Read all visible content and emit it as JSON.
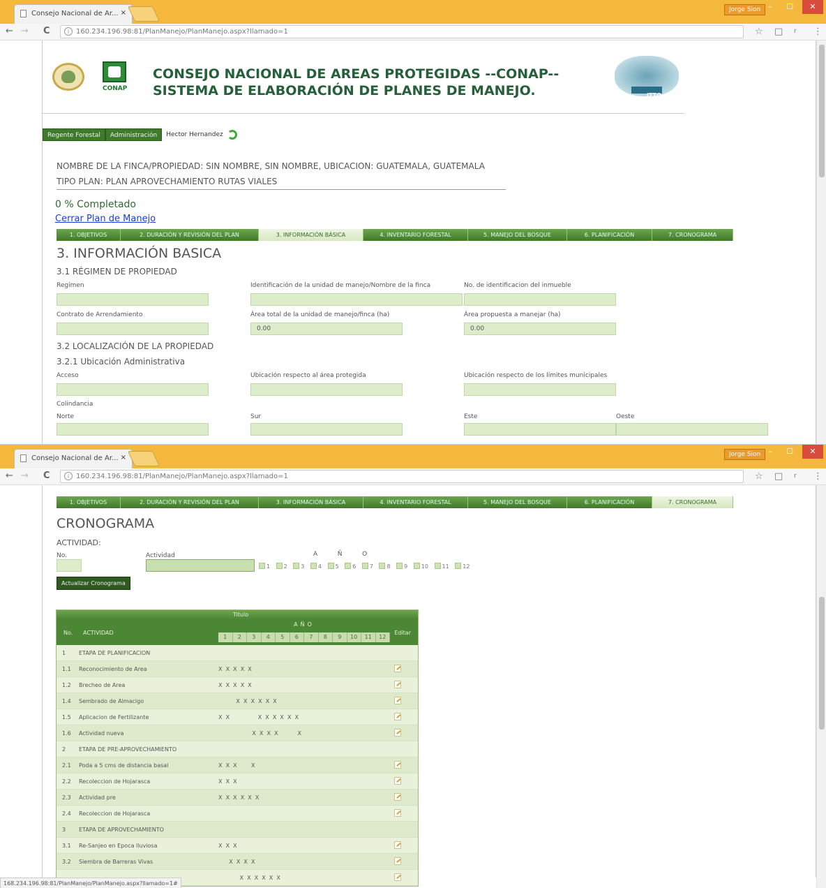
{
  "browser": {
    "tab_title": "Consejo Nacional de Ar...",
    "tab_close": "×",
    "user_name": "Jorge Sion",
    "url": "160.234.196.98:81/PlanManejo/PlanManejo.aspx?llamado=1",
    "status_url": "168.234.196.98:81/PlanManejo/PlanManejo.aspx?llamado=1#",
    "back": "←",
    "forward": "→",
    "reload": "C",
    "info": "i",
    "star": "☆",
    "ext": "□",
    "menu": "⋮",
    "r": "r",
    "min": "–",
    "max": "☐",
    "close": "✕"
  },
  "header": {
    "line1": "CONSEJO NACIONAL DE AREAS PROTEGIDAS --CONAP--",
    "line2": "SISTEMA DE ELABORACIÓN DE PLANES DE MANEJO.",
    "conap_logo_text": "CONAP",
    "itto_logo_text": "ITTO"
  },
  "menu": {
    "items": [
      "Regente Forestal",
      "Administración"
    ],
    "user": "Hector Hernandez"
  },
  "finca": {
    "line1": "NOMBRE DE LA FINCA/PROPIEDAD: SIN NOMBRE, SIN NOMBRE, UBICACION: GUATEMALA, GUATEMALA",
    "line2": "TIPO PLAN: PLAN APROVECHAMIENTO RUTAS VIALES"
  },
  "progress": {
    "text": "0 % Completado",
    "value_percent": 0
  },
  "cerrar": "Cerrar Plan de Manejo",
  "steps": [
    "1. OBJETIVOS",
    "2. DURACIÓN Y REVISIÓN DEL PLAN",
    "3. INFORMACIÓN BÁSICA",
    "4. INVENTARIO FORESTAL",
    "5. MANEJO DEL BOSQUE",
    "6. PLANIFICACIÓN",
    "7. CRONOGRAMA"
  ],
  "info": {
    "title": "3. INFORMACIÓN BASICA",
    "regimen_title": "3.1 RÉGIMEN DE PROPIEDAD",
    "regimen_label": "Regimen",
    "identificacion_label": "Identificación de la unidad de manejo/Nombre de la finca",
    "no_ident_label": "No. de identificacion del inmueble",
    "contrato_label": "Contrato de Arrendamiento",
    "area_total_label": "Área total de la unidad de manejo/finca (ha)",
    "area_total_value": "0.00",
    "area_propuesta_label": "Área propuesta a manejar (ha)",
    "area_propuesta_value": "0.00",
    "localizacion_title": "3.2 LOCALIZACIÓN DE LA PROPIEDAD",
    "ubicacion_title": "3.2.1 Ubicación Administrativa",
    "acceso_label": "Acceso",
    "ubic_area_label": "Ubicación respecto al área protegida",
    "ubic_limites_label": "Ubicación respecto de los límites municipales",
    "colindancia_label": "Colindancia",
    "norte": "Norte",
    "sur": "Sur",
    "este": "Este",
    "oeste": "Oeste"
  },
  "crono": {
    "title": "CRONOGRAMA",
    "actividad_title": "ACTIVIDAD:",
    "no_label": "No.",
    "actividad_label": "Actividad",
    "anio_letters": "A          Ñ          O",
    "months": [
      "1",
      "2",
      "3",
      "4",
      "5",
      "6",
      "7",
      "8",
      "9",
      "10",
      "11",
      "12"
    ],
    "button": "Actualizar Cronograma",
    "grid_titulo": "Titulo",
    "grid_no": "No.",
    "grid_actividad": "ACTIVIDAD",
    "grid_anio": "AÑO",
    "grid_editar": "Editar",
    "grid_months": [
      "1",
      "2",
      "3",
      "4",
      "5",
      "6",
      "7",
      "8",
      "9",
      "10",
      "11",
      "12"
    ],
    "rows": [
      {
        "no": "1",
        "act": "ETAPA DE PLANIFICACION",
        "marks": "",
        "edit": false
      },
      {
        "no": "1.1",
        "act": "Reconocimiento de Area",
        "marks": "X  X  X  X  X",
        "edit": true
      },
      {
        "no": "1.2",
        "act": "Brecheo de Area",
        "marks": "X  X  X  X  X",
        "edit": true
      },
      {
        "no": "1.4",
        "act": "Sembrado de Almacigo",
        "marks": "          X  X  X  X  X  X",
        "edit": true
      },
      {
        "no": "1.5",
        "act": "Aplicacion de Fertilizante",
        "marks": "X  X                X  X  X  X  X  X",
        "edit": true
      },
      {
        "no": "1.6",
        "act": "Actividad nueva",
        "marks": "                   X  X  X  X           X",
        "edit": true
      },
      {
        "no": "2",
        "act": "ETAPA DE PRE-APROVECHAMIENTO",
        "marks": "",
        "edit": false
      },
      {
        "no": "2.1",
        "act": "Poda a 5 cms de distancia basal",
        "marks": "X  X  X        X",
        "edit": true
      },
      {
        "no": "2.2",
        "act": "Recoleccion de Hojarasca",
        "marks": "X  X  X",
        "edit": true
      },
      {
        "no": "2.3",
        "act": "Actividad pre",
        "marks": "X  X  X  X  X  X",
        "edit": true
      },
      {
        "no": "2.4",
        "act": "Recoleccion de Hojarasca",
        "marks": "",
        "edit": true
      },
      {
        "no": "3",
        "act": "ETAPA DE APROVECHAMIENTO",
        "marks": "",
        "edit": false
      },
      {
        "no": "3.1",
        "act": "Re-Sanjeo en Epoca lluviosa",
        "marks": "X  X  X",
        "edit": true
      },
      {
        "no": "3.2",
        "act": "Siembra de Barreras Vivas",
        "marks": "      X  X  X  X",
        "edit": true
      },
      {
        "no": "",
        "act": "",
        "marks": "            X  X  X  X  X  X",
        "edit": true
      }
    ]
  }
}
